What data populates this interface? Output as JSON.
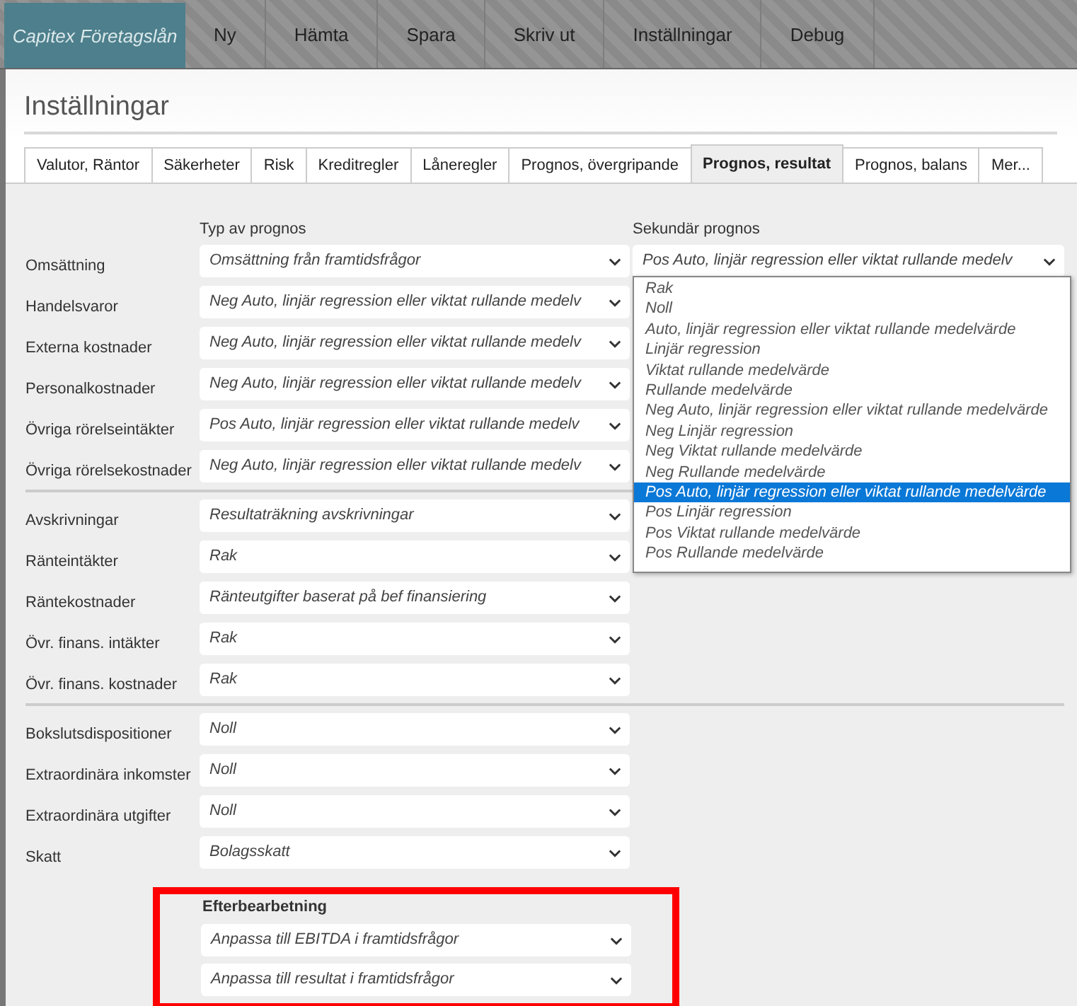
{
  "app": {
    "brand": "Capitex Företagslån",
    "menu": [
      {
        "label": "Ny"
      },
      {
        "label": "Hämta"
      },
      {
        "label": "Spara"
      },
      {
        "label": "Skriv ut"
      },
      {
        "label": "Inställningar"
      },
      {
        "label": "Debug"
      }
    ]
  },
  "page_title": "Inställningar",
  "tabs": [
    {
      "label": "Valutor, Räntor",
      "selected": false
    },
    {
      "label": "Säkerheter",
      "selected": false
    },
    {
      "label": "Risk",
      "selected": false
    },
    {
      "label": "Kreditregler",
      "selected": false
    },
    {
      "label": "Låneregler",
      "selected": false
    },
    {
      "label": "Prognos, övergripande",
      "selected": false
    },
    {
      "label": "Prognos, resultat",
      "selected": true
    },
    {
      "label": "Prognos, balans",
      "selected": false
    },
    {
      "label": "Mer...",
      "selected": false
    }
  ],
  "column_headers": {
    "primary": "Typ av prognos",
    "secondary": "Sekundär prognos"
  },
  "sections": [
    {
      "rows": [
        {
          "label": "Omsättning",
          "value": "Omsättning från framtidsfrågor",
          "secondary": "Pos Auto, linjär regression eller viktat rullande medelv"
        },
        {
          "label": "Handelsvaror",
          "value": "Neg Auto, linjär regression eller viktat rullande medelv"
        },
        {
          "label": "Externa kostnader",
          "value": "Neg Auto, linjär regression eller viktat rullande medelv"
        },
        {
          "label": "Personalkostnader",
          "value": "Neg Auto, linjär regression eller viktat rullande medelv"
        },
        {
          "label": "Övriga rörelseintäkter",
          "value": "Pos Auto, linjär regression eller viktat rullande medelv"
        },
        {
          "label": "Övriga rörelsekostnader",
          "value": "Neg Auto, linjär regression eller viktat rullande medelv"
        }
      ]
    },
    {
      "rows": [
        {
          "label": "Avskrivningar",
          "value": "Resultaträkning avskrivningar"
        },
        {
          "label": "Ränteintäkter",
          "value": "Rak"
        },
        {
          "label": "Räntekostnader",
          "value": "Ränteutgifter baserat på bef finansiering"
        },
        {
          "label": "Övr. finans. intäkter",
          "value": "Rak"
        },
        {
          "label": "Övr. finans. kostnader",
          "value": "Rak"
        }
      ]
    },
    {
      "rows": [
        {
          "label": "Bokslutsdispositioner",
          "value": "Noll"
        },
        {
          "label": "Extraordinära inkomster",
          "value": "Noll"
        },
        {
          "label": "Extraordinära utgifter",
          "value": "Noll"
        },
        {
          "label": "Skatt",
          "value": "Bolagsskatt"
        }
      ]
    }
  ],
  "secondary_dropdown": {
    "options": [
      {
        "label": "Rak",
        "selected": false
      },
      {
        "label": "Noll",
        "selected": false
      },
      {
        "label": "Auto, linjär regression eller viktat rullande medelvärde",
        "selected": false
      },
      {
        "label": "Linjär regression",
        "selected": false
      },
      {
        "label": "Viktat rullande medelvärde",
        "selected": false
      },
      {
        "label": "Rullande medelvärde",
        "selected": false
      },
      {
        "label": "Neg Auto, linjär regression eller viktat rullande medelvärde",
        "selected": false
      },
      {
        "label": "Neg Linjär regression",
        "selected": false
      },
      {
        "label": "Neg Viktat rullande medelvärde",
        "selected": false
      },
      {
        "label": "Neg Rullande medelvärde",
        "selected": false
      },
      {
        "label": "Pos Auto, linjär regression eller viktat rullande medelvärde",
        "selected": true
      },
      {
        "label": "Pos Linjär regression",
        "selected": false
      },
      {
        "label": "Pos Viktat rullande medelvärde",
        "selected": false
      },
      {
        "label": "Pos Rullande medelvärde",
        "selected": false
      }
    ]
  },
  "postprocessing": {
    "heading": "Efterbearbetning",
    "highlighted": true,
    "selects": [
      {
        "value": "Anpassa till EBITDA i framtidsfrågor"
      },
      {
        "value": "Anpassa till resultat i framtidsfrågor"
      }
    ]
  }
}
